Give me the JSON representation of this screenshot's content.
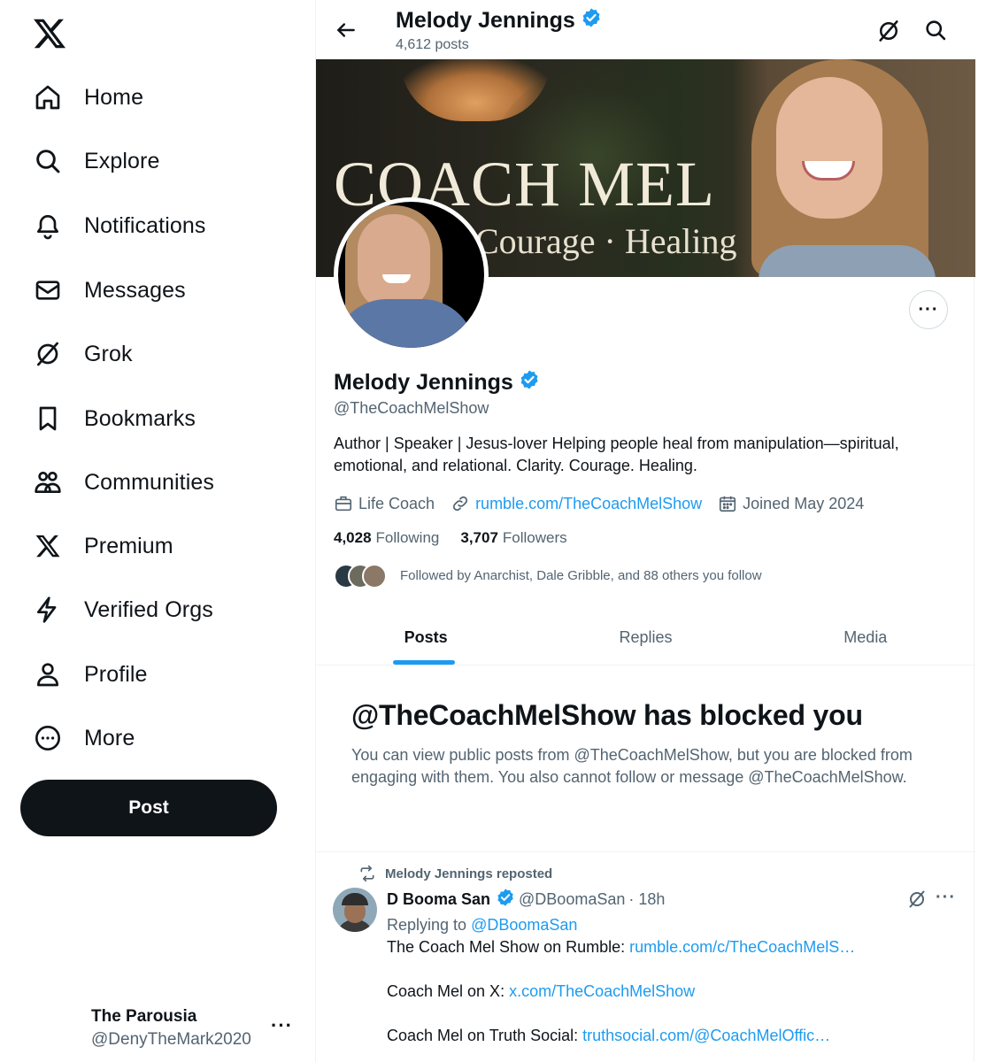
{
  "sidebar": {
    "logo": "x-logo-icon",
    "items": [
      {
        "label": "Home",
        "icon": "home-icon"
      },
      {
        "label": "Explore",
        "icon": "search-icon"
      },
      {
        "label": "Notifications",
        "icon": "bell-icon"
      },
      {
        "label": "Messages",
        "icon": "envelope-icon"
      },
      {
        "label": "Grok",
        "icon": "grok-icon"
      },
      {
        "label": "Bookmarks",
        "icon": "bookmark-icon"
      },
      {
        "label": "Communities",
        "icon": "people-icon"
      },
      {
        "label": "Premium",
        "icon": "x-logo-icon"
      },
      {
        "label": "Verified Orgs",
        "icon": "lightning-icon"
      },
      {
        "label": "Profile",
        "icon": "person-icon"
      },
      {
        "label": "More",
        "icon": "more-circle-icon"
      }
    ],
    "post_label": "Post",
    "account": {
      "name": "The Parousia",
      "handle": "@DenyTheMark2020",
      "more": "···"
    }
  },
  "header": {
    "name": "Melody Jennings",
    "posts_count": "4,612 posts"
  },
  "banner": {
    "title": "COACH MEL",
    "subtitle": "Courage · Healing"
  },
  "profile": {
    "name": "Melody Jennings",
    "handle": "@TheCoachMelShow",
    "bio": "Author | Speaker | Jesus-lover Helping people heal from manipulation—spiritual, emotional, and relational. Clarity. Courage. Healing.",
    "category": "Life Coach",
    "link": "rumble.com/TheCoachMelShow",
    "joined": "Joined May 2024",
    "following_count": "4,028",
    "following_label": "Following",
    "followers_count": "3,707",
    "followers_label": "Followers",
    "followed_by": "Followed by Anarchist, Dale Gribble, and 88 others you follow",
    "more": "···"
  },
  "tabs": [
    {
      "label": "Posts",
      "active": true
    },
    {
      "label": "Replies",
      "active": false
    },
    {
      "label": "Media",
      "active": false
    }
  ],
  "blocked": {
    "title": "@TheCoachMelShow has blocked you",
    "message": "You can view public posts from @TheCoachMelShow, but you are blocked from engaging with them. You also cannot follow or message @TheCoachMelShow."
  },
  "tweet": {
    "repost_label": "Melody Jennings reposted",
    "name": "D Booma San",
    "handle": "@DBoomaSan",
    "time": "· 18h",
    "replying_prefix": "Replying to",
    "replying_to": "@DBoomaSan",
    "lines": [
      {
        "text": "The Coach Mel Show on Rumble: ",
        "link": "rumble.com/c/TheCoachMelS…"
      },
      {
        "text": "Coach Mel on X: ",
        "link": "x.com/TheCoachMelShow"
      },
      {
        "text": "Coach Mel on Truth Social: ",
        "link": "truthsocial.com/@CoachMelOffic…"
      }
    ],
    "more": "···"
  },
  "colors": {
    "accent": "#1d9bf0",
    "text": "#0f1419",
    "muted": "#536471",
    "post_button": "#0f1419"
  }
}
